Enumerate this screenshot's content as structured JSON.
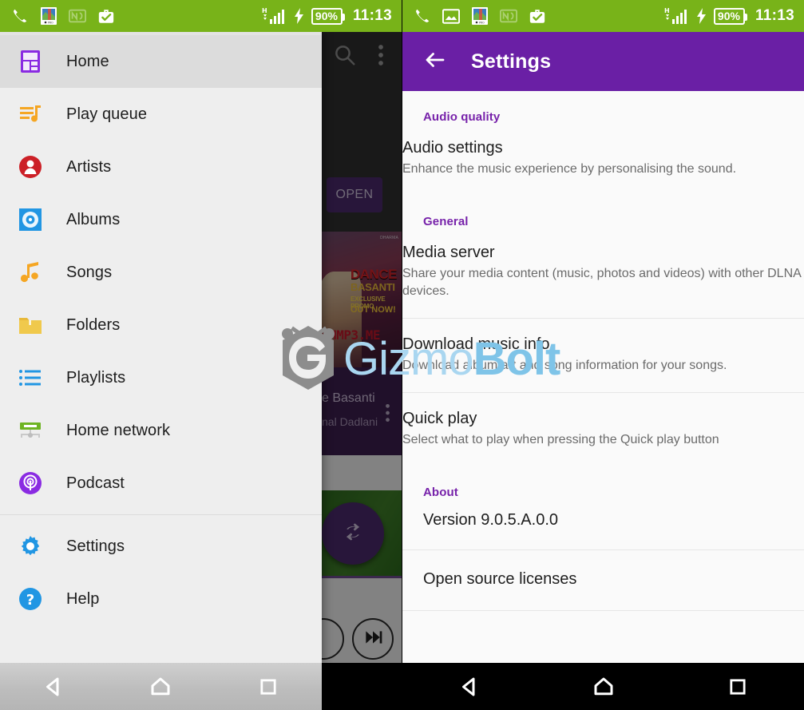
{
  "status_bar": {
    "icons_left": [
      "phone-call-icon",
      "image-icon",
      "photo-app-icon",
      "nfc-icon",
      "work-profile-icon"
    ],
    "icons_left_right_panel": [
      "phone-call-icon",
      "image-icon",
      "photo-app-icon",
      "nfc-icon",
      "work-profile-icon"
    ],
    "network_type": "H",
    "signal_icon": "signal-bars-icon",
    "charging_icon": "charging-bolt-icon",
    "battery": "90%",
    "time": "11:13",
    "background": "#78b319"
  },
  "drawer": {
    "items": [
      {
        "label": "Home",
        "icon": "home-dashboard-icon",
        "selected": true
      },
      {
        "label": "Play queue",
        "icon": "play-queue-icon",
        "selected": false
      },
      {
        "label": "Artists",
        "icon": "artist-person-icon",
        "selected": false
      },
      {
        "label": "Albums",
        "icon": "album-disc-icon",
        "selected": false
      },
      {
        "label": "Songs",
        "icon": "music-note-icon",
        "selected": false
      },
      {
        "label": "Folders",
        "icon": "folder-icon",
        "selected": false
      },
      {
        "label": "Playlists",
        "icon": "playlist-lines-icon",
        "selected": false
      },
      {
        "label": "Home network",
        "icon": "home-network-icon",
        "selected": false
      },
      {
        "label": "Podcast",
        "icon": "podcast-icon",
        "selected": false
      }
    ],
    "footer_items": [
      {
        "label": "Settings",
        "icon": "gear-icon"
      },
      {
        "label": "Help",
        "icon": "help-question-icon"
      }
    ]
  },
  "background_app": {
    "search_icon": "search-icon",
    "overflow_icon": "overflow-menu-icon",
    "open_button": "OPEN",
    "album_art": {
      "brand": "DHARMA",
      "line1": "DANCE",
      "line2": "BASANTI",
      "line3": "EXCLUSIVE PROMO",
      "line4": "OUT NOW!",
      "site": "PHMP3.ME"
    },
    "track_title": "e Basanti",
    "track_artist": "nal Dadlani",
    "fab_icon": "repeat-icon",
    "next_icon": "next-track-icon",
    "row_overflow_icon": "overflow-menu-icon"
  },
  "settings": {
    "back_icon": "back-arrow-icon",
    "title": "Settings",
    "sections": [
      {
        "heading": "Audio quality",
        "items": [
          {
            "title": "Audio settings",
            "subtitle": "Enhance the music experience by personalising the sound."
          }
        ]
      },
      {
        "heading": "General",
        "items": [
          {
            "title": "Media server",
            "subtitle": "Share your media content (music, photos and videos) with other DLNA devices."
          },
          {
            "title": "Download music info",
            "subtitle": "Download album art and song information for your songs."
          },
          {
            "title": "Quick play",
            "subtitle": "Select what to play when pressing the Quick play button"
          }
        ]
      },
      {
        "heading": "About",
        "items": [
          {
            "title": "Version 9.0.5.A.0.0",
            "subtitle": ""
          },
          {
            "title": "Open source licenses",
            "subtitle": ""
          }
        ]
      }
    ]
  },
  "nav_bar": {
    "back": "back-triangle-icon",
    "home": "home-pentagon-icon",
    "recents": "recents-square-icon"
  },
  "watermark": {
    "part1": "Gizmo",
    "part2": "Bolt",
    "logo": "gizmobolt-g-hex-logo"
  },
  "colors": {
    "status_bar_green": "#78b319",
    "appbar_purple": "#6a1fa5",
    "section_heading_purple": "#7722aa",
    "drawer_bg": "#eeeeee",
    "selected_row": "#dcdcdc"
  }
}
